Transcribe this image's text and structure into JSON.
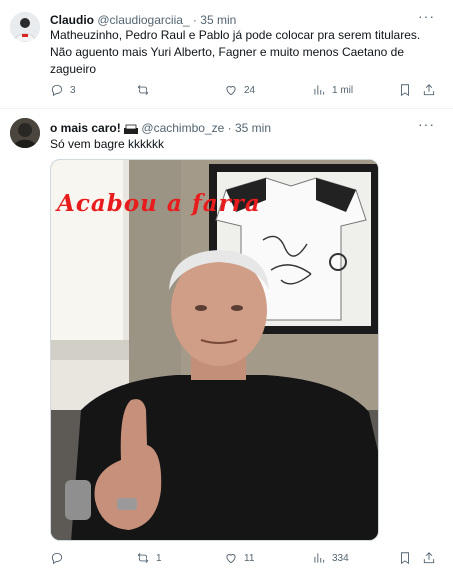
{
  "tweets": [
    {
      "name": "Claudio",
      "handle": "@claudiogarciia_",
      "dot": "·",
      "time": "35 min",
      "text_lines": [
        "Matheuzinho, Pedro Raul e Pablo já pode colocar pra serem titulares.",
        "Não aguento mais  Yuri Alberto, Fagner e muito menos Caetano de",
        "zagueiro"
      ],
      "replies": "3",
      "retweets": "",
      "likes": "24",
      "views": "1 mil"
    },
    {
      "name": "o mais caro!",
      "handle": "@cachimbo_ze",
      "dot": "·",
      "time": "35 min",
      "text": "Só vem bagre kkkkkk",
      "media_overlay_text": "Acabou a farra",
      "replies": "",
      "retweets": "1",
      "likes": "11",
      "views": "334"
    }
  ],
  "icons": {
    "more": "more-horizontal-icon",
    "reply": "reply-icon",
    "retweet": "retweet-icon",
    "like": "heart-icon",
    "views": "views-bar-icon",
    "bookmark": "bookmark-icon",
    "share": "share-icon",
    "badge": "emoji-badge-icon"
  },
  "colors": {
    "text_primary": "#0f1419",
    "text_secondary": "#536471",
    "divider": "#eff3f4",
    "overlay_red": "#e81c1c"
  }
}
